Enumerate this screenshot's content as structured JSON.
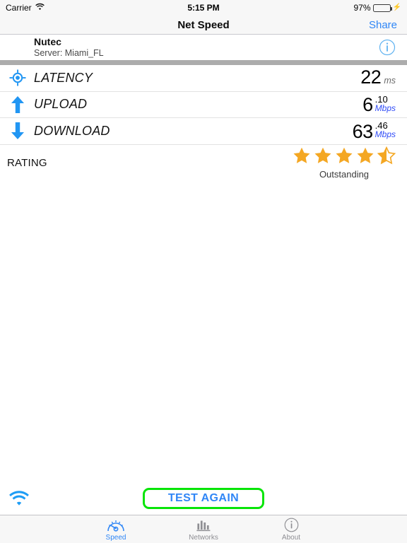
{
  "status_bar": {
    "carrier": "Carrier",
    "wifi_icon": "wifi-icon",
    "time": "5:15 PM",
    "battery_percent": "97%",
    "battery_level": 97,
    "charging_icon": "lightning-bolt-icon"
  },
  "nav_bar": {
    "title": "Net Speed",
    "share_label": "Share"
  },
  "server": {
    "name": "Nutec",
    "detail": "Server: Miami_FL",
    "info_icon": "info-circle-icon"
  },
  "metrics": [
    {
      "icon": "crosshair-target-icon",
      "label": "LATENCY",
      "value": "22",
      "decimal": "",
      "unit": "ms",
      "unit_color": "#6b6b6b"
    },
    {
      "icon": "arrow-up-icon",
      "label": "UPLOAD",
      "value": "6",
      "decimal": ".10",
      "unit": "Mbps",
      "unit_color": "#2f4bf7"
    },
    {
      "icon": "arrow-down-icon",
      "label": "DOWNLOAD",
      "value": "63",
      "decimal": ".46",
      "unit": "Mbps",
      "unit_color": "#2f4bf7"
    }
  ],
  "rating": {
    "label": "RATING",
    "stars_filled": 4,
    "stars_half": 1,
    "stars_total": 5,
    "score": 4.5,
    "word": "Outstanding",
    "star_color": "#f4a723"
  },
  "action_bar": {
    "wifi_icon": "wifi-icon",
    "test_button_label": "TEST AGAIN",
    "test_button_border_color": "#08e508",
    "test_button_text_color": "#2f86f6"
  },
  "tab_bar": {
    "active_color": "#2f86f6",
    "inactive_color": "#8e8e93",
    "tabs": [
      {
        "icon": "speedometer-icon",
        "label": "Speed",
        "active": true
      },
      {
        "icon": "bar-chart-icon",
        "label": "Networks",
        "active": false
      },
      {
        "icon": "info-circle-icon",
        "label": "About",
        "active": false
      }
    ]
  }
}
